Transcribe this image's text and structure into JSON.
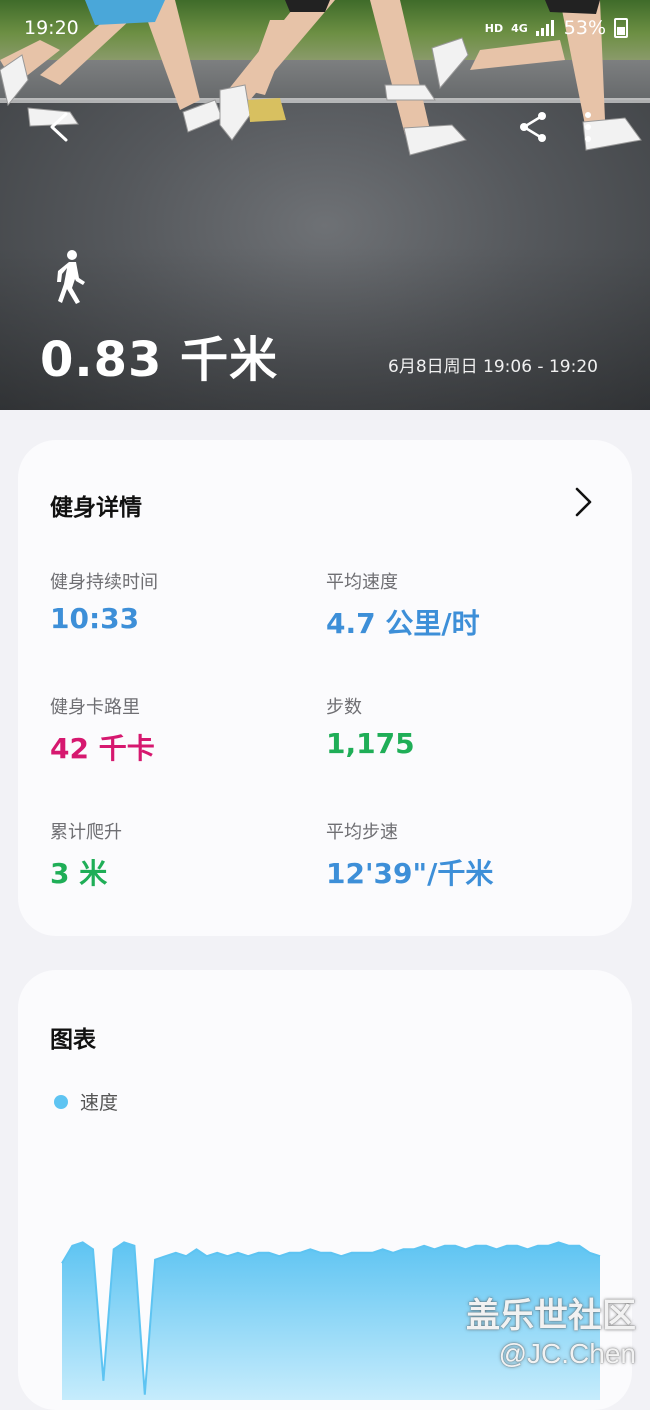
{
  "status_bar": {
    "time": "19:20",
    "network_hd": "HD",
    "network_4g": "4G",
    "battery": "53%"
  },
  "hero": {
    "activity_icon": "walking-person-icon",
    "distance": "0.83 千米",
    "time_range": "6月8日周日 19:06 - 19:20"
  },
  "details": {
    "title": "健身详情",
    "metrics": [
      {
        "label": "健身持续时间",
        "value": "10:33",
        "color": "#3d8fd8"
      },
      {
        "label": "平均速度",
        "value": "4.7 公里/时",
        "color": "#3d8fd8"
      },
      {
        "label": "健身卡路里",
        "value": "42 千卡",
        "color": "#d6186f"
      },
      {
        "label": "步数",
        "value": "1,175",
        "color": "#1fae57"
      },
      {
        "label": "累计爬升",
        "value": "3 米",
        "color": "#1fae57"
      },
      {
        "label": "平均步速",
        "value": "12'39\"/千米",
        "color": "#3d8fd8"
      }
    ]
  },
  "chart_section": {
    "title": "图表",
    "legend_label": "速度",
    "legend_color": "#5ec4f2"
  },
  "chart_data": {
    "type": "area",
    "title": "",
    "xlabel": "",
    "ylabel": "",
    "series": [
      {
        "name": "速度",
        "values": [
          4.6,
          5.1,
          5.2,
          5.0,
          1.2,
          5.0,
          5.2,
          5.1,
          0.8,
          4.7,
          4.8,
          4.9,
          4.8,
          5.0,
          4.8,
          4.9,
          4.8,
          4.9,
          4.8,
          4.9,
          4.9,
          4.8,
          4.9,
          4.9,
          5.0,
          4.9,
          4.9,
          4.8,
          4.9,
          4.9,
          4.9,
          5.0,
          4.9,
          5.0,
          5.0,
          5.1,
          5.0,
          5.1,
          5.1,
          5.0,
          5.1,
          5.1,
          5.0,
          5.1,
          5.1,
          5.0,
          5.1,
          5.1,
          5.2,
          5.1,
          5.1,
          4.9,
          4.8
        ]
      }
    ]
  },
  "watermark": {
    "line1": "盖乐世社区",
    "line2": "@JC.Chen"
  }
}
